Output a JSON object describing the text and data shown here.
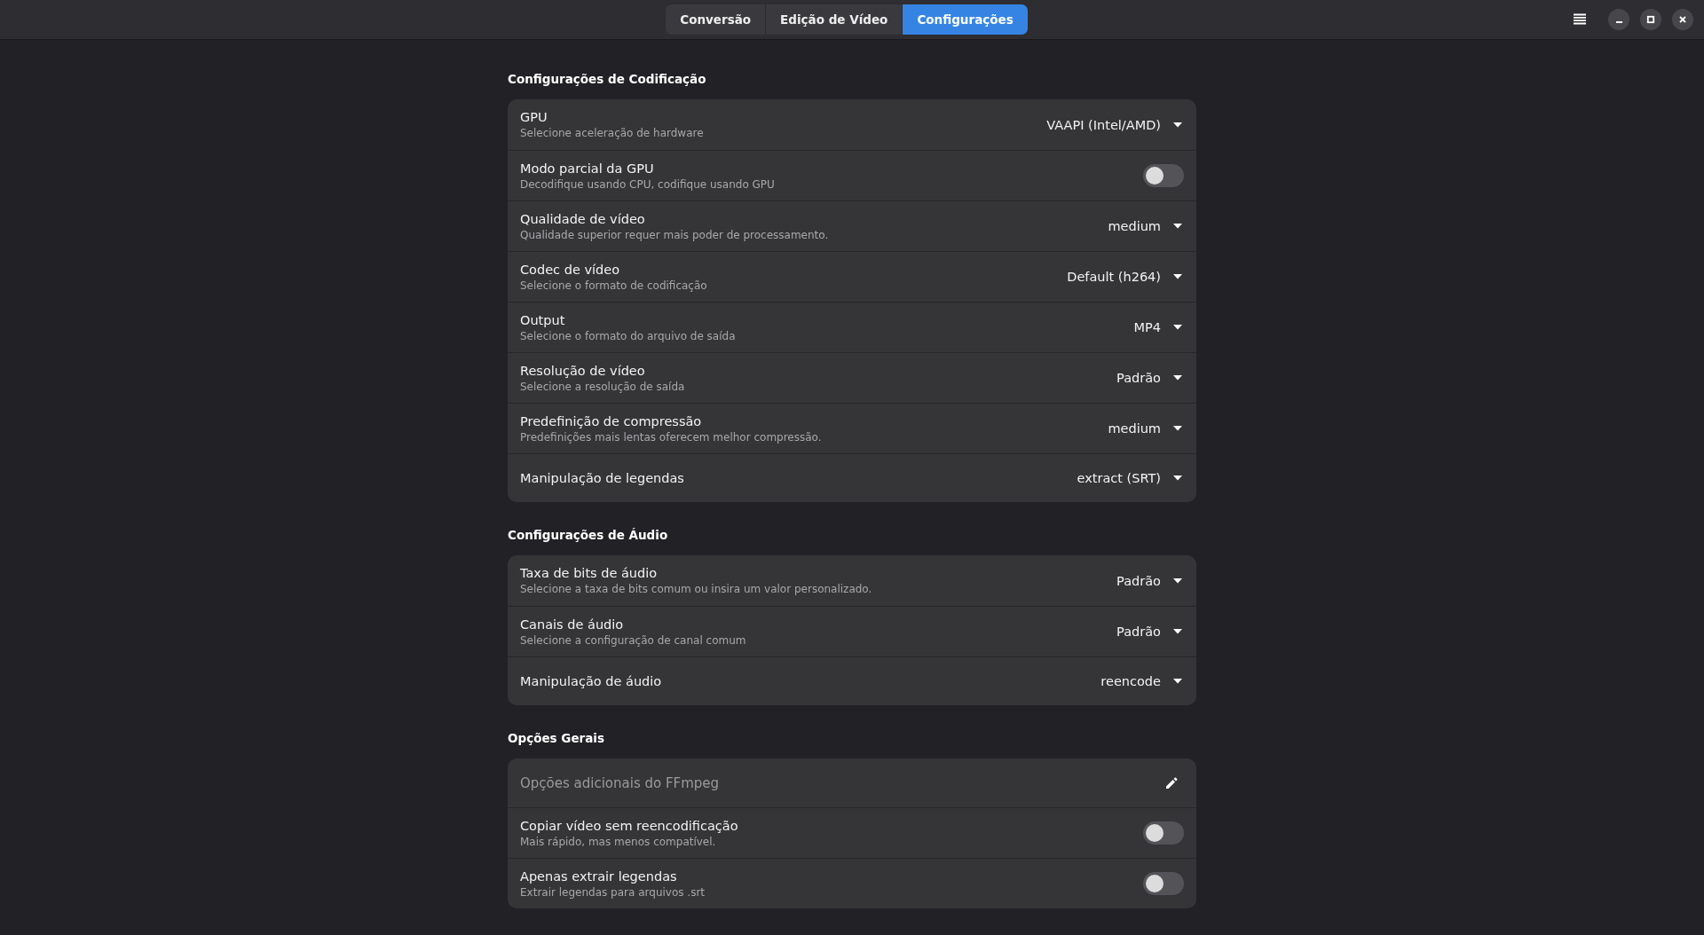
{
  "tabs": [
    {
      "label": "Conversão",
      "selected": false
    },
    {
      "label": "Edição de Vídeo",
      "selected": false
    },
    {
      "label": "Configurações",
      "selected": true
    }
  ],
  "sections": [
    {
      "title": "Configurações de Codificação",
      "rows": [
        {
          "kind": "dropdown",
          "title": "GPU",
          "subtitle": "Selecione aceleração de hardware",
          "value": "VAAPI (Intel/AMD)"
        },
        {
          "kind": "switch",
          "title": "Modo parcial da GPU",
          "subtitle": "Decodifique usando CPU, codifique usando GPU",
          "on": false
        },
        {
          "kind": "dropdown",
          "title": "Qualidade de vídeo",
          "subtitle": "Qualidade superior requer mais poder de processamento.",
          "value": "medium"
        },
        {
          "kind": "dropdown",
          "title": "Codec de vídeo",
          "subtitle": "Selecione o formato de codificação",
          "value": "Default (h264)"
        },
        {
          "kind": "dropdown",
          "title": "Output",
          "subtitle": "Selecione o formato do arquivo de saída",
          "value": "MP4"
        },
        {
          "kind": "dropdown",
          "title": "Resolução de vídeo",
          "subtitle": "Selecione a resolução de saída",
          "value": "Padrão"
        },
        {
          "kind": "dropdown",
          "title": "Predefinição de compressão",
          "subtitle": "Predefinições mais lentas oferecem melhor compressão.",
          "value": "medium"
        },
        {
          "kind": "dropdown",
          "title": "Manipulação de legendas",
          "value": "extract (SRT)"
        }
      ]
    },
    {
      "title": "Configurações de Áudio",
      "rows": [
        {
          "kind": "dropdown",
          "title": "Taxa de bits de áudio",
          "subtitle": "Selecione a taxa de bits comum ou insira um valor personalizado.",
          "value": "Padrão"
        },
        {
          "kind": "dropdown",
          "title": "Canais de áudio",
          "subtitle": "Selecione a configuração de canal comum",
          "value": "Padrão"
        },
        {
          "kind": "dropdown",
          "title": "Manipulação de áudio",
          "value": "reencode"
        }
      ]
    },
    {
      "title": "Opções Gerais",
      "rows": [
        {
          "kind": "entry",
          "placeholder": "Opções adicionais do FFmpeg"
        },
        {
          "kind": "switch",
          "title": "Copiar vídeo sem reencodificação",
          "subtitle": "Mais rápido, mas menos compatível.",
          "on": false
        },
        {
          "kind": "switch",
          "title": "Apenas extrair legendas",
          "subtitle": "Extrair legendas para arquivos .srt",
          "on": false
        }
      ]
    }
  ]
}
